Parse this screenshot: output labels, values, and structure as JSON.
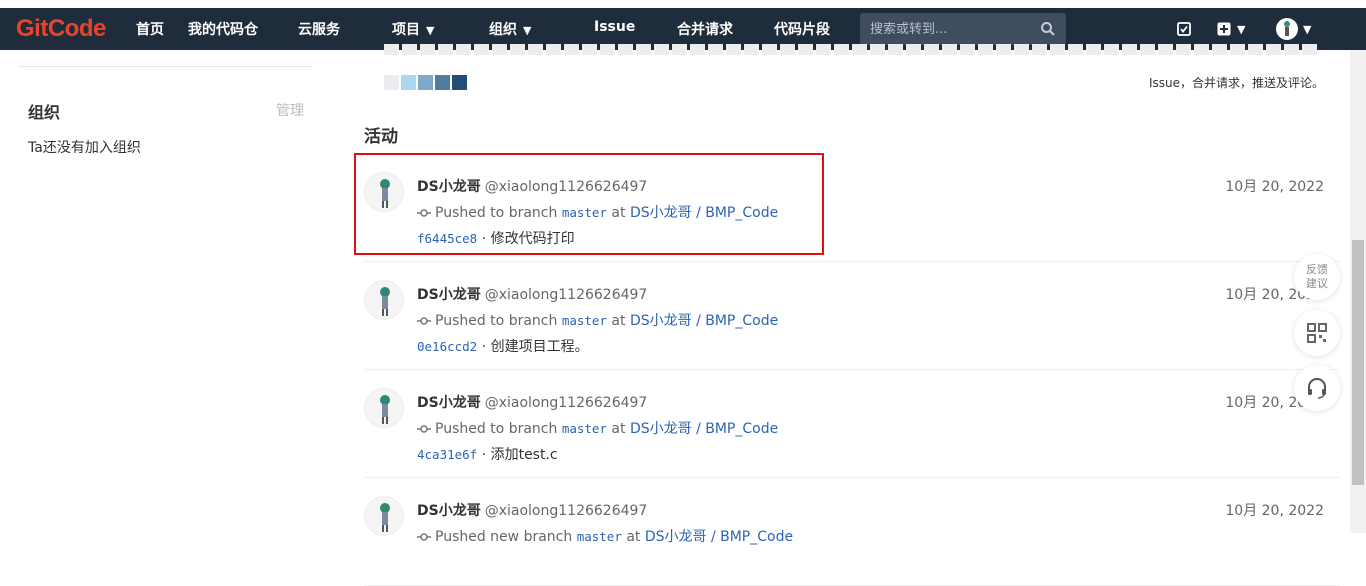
{
  "nav": {
    "logo": "GitCode",
    "items": [
      "首页",
      "我的代码仓",
      "云服务",
      "项目",
      "组织",
      "Issue",
      "合并请求",
      "代码片段"
    ],
    "search_placeholder": "搜索或转到..."
  },
  "sidebar": {
    "org_title": "组织",
    "org_manage": "管理",
    "org_empty": "Ta还没有加入组织"
  },
  "heatmap": {
    "legend_colors": [
      "#ebedf0",
      "#acd5f2",
      "#7fa8c9",
      "#527ba0",
      "#254e77"
    ],
    "note": "Issue，合并请求，推送及评论。"
  },
  "activity": {
    "title": "活动",
    "entries": [
      {
        "name": "DS小龙哥",
        "handle": "@xiaolong1126626497",
        "action": "Pushed to branch",
        "branch": "master",
        "at": "at",
        "repo": "DS小龙哥 / BMP_Code",
        "sha": "f6445ce8",
        "message": "修改代码打印",
        "date": "10月 20, 2022"
      },
      {
        "name": "DS小龙哥",
        "handle": "@xiaolong1126626497",
        "action": "Pushed to branch",
        "branch": "master",
        "at": "at",
        "repo": "DS小龙哥 / BMP_Code",
        "sha": "0e16ccd2",
        "message": "创建项目工程。",
        "date": "10月 20, 2022"
      },
      {
        "name": "DS小龙哥",
        "handle": "@xiaolong1126626497",
        "action": "Pushed to branch",
        "branch": "master",
        "at": "at",
        "repo": "DS小龙哥 / BMP_Code",
        "sha": "4ca31e6f",
        "message": "添加test.c",
        "date": "10月 20, 2022"
      },
      {
        "name": "DS小龙哥",
        "handle": "@xiaolong1126626497",
        "action": "Pushed new branch",
        "branch": "master",
        "at": "at",
        "repo": "DS小龙哥 / BMP_Code",
        "sha": "",
        "message": "",
        "date": "10月 20, 2022"
      }
    ]
  },
  "floating": {
    "feedback": "反馈\n建议"
  },
  "colors": {
    "nav_bg": "#1f2c3c",
    "brand": "#e8442c",
    "link": "#2b64b2",
    "highlight": "#e01010"
  }
}
